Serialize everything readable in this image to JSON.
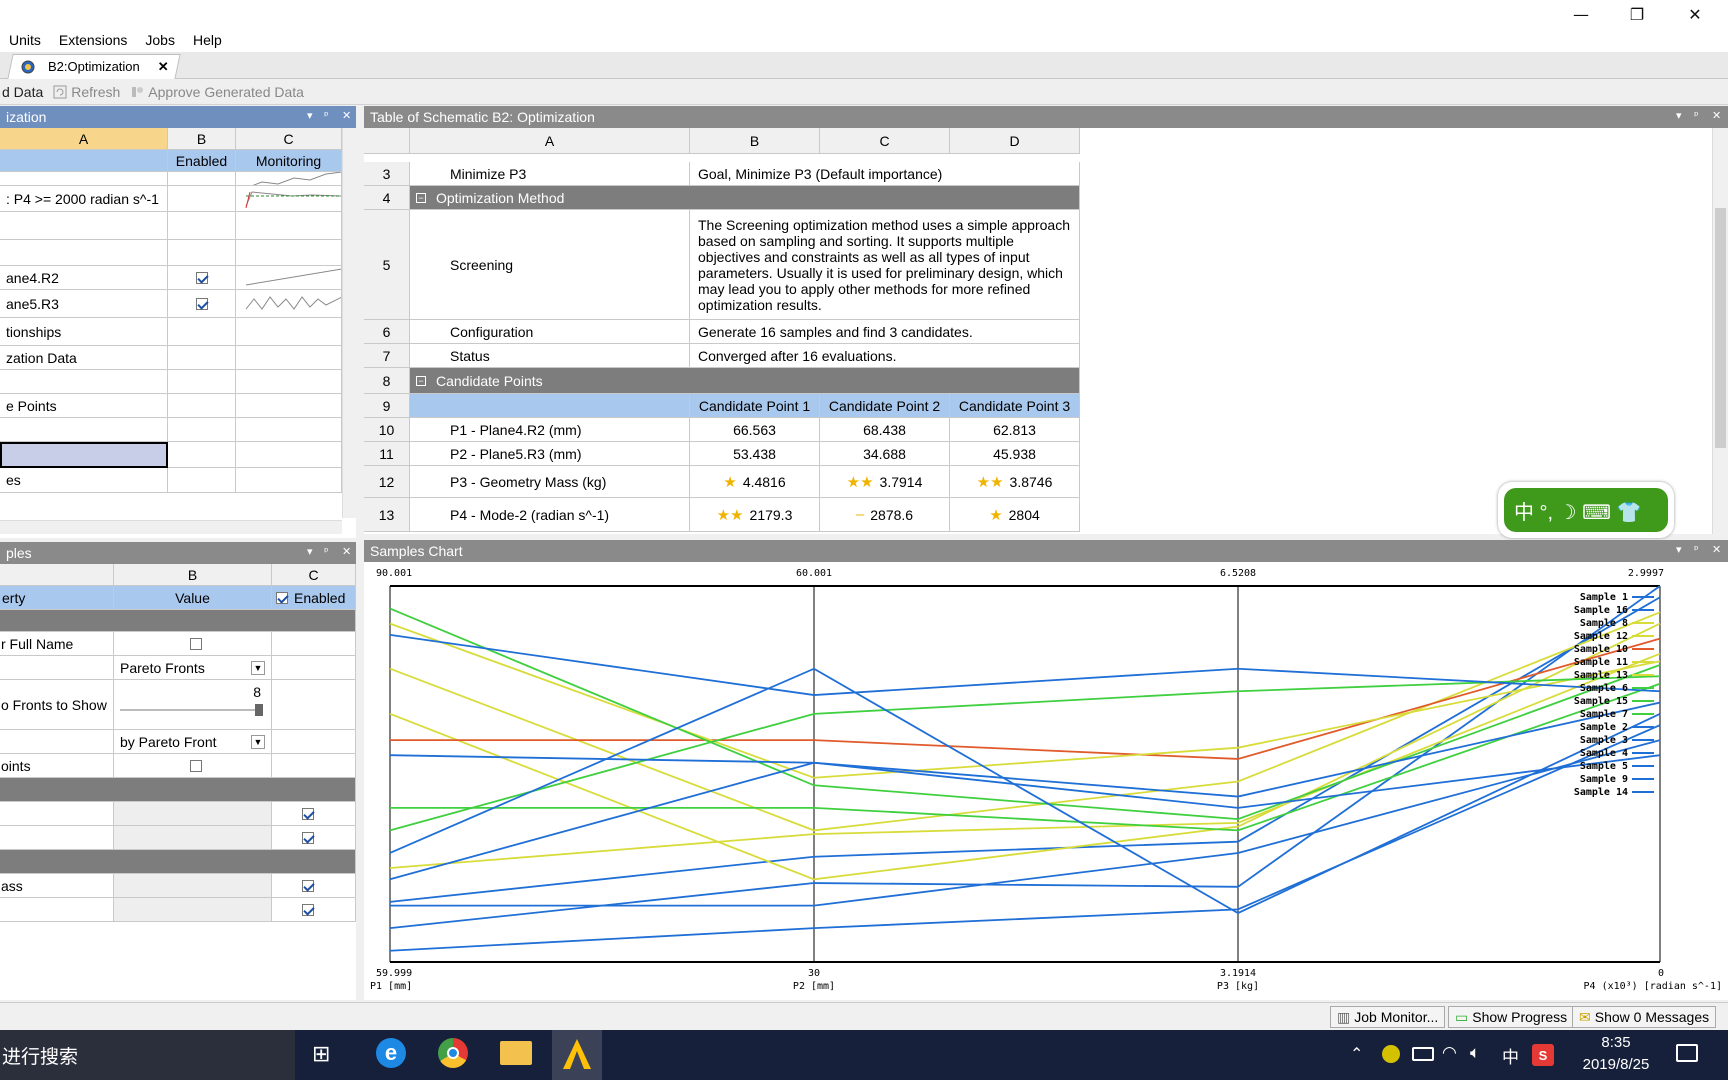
{
  "window_controls": {
    "minimize": "—",
    "restore": "❐",
    "close": "✕"
  },
  "menu": [
    "Units",
    "Extensions",
    "Jobs",
    "Help"
  ],
  "doc_tab": {
    "label": "B2:Optimization",
    "close": "✕"
  },
  "toolbar": {
    "update_label": "d Data",
    "refresh_label": "Refresh",
    "approve_label": "Approve Generated Data"
  },
  "outline": {
    "title": "ization",
    "col_a": "A",
    "col_b": "B",
    "col_c": "C",
    "hdr_b": "Enabled",
    "hdr_c": "Monitoring",
    "rows": [
      "",
      ": P4 >= 2000 radian s^-1",
      "",
      "",
      "ane4.R2",
      "ane5.R3",
      "tionships",
      "zation Data",
      "",
      "e Points",
      "",
      "",
      "es"
    ]
  },
  "props": {
    "title": "ples",
    "col_b": "B",
    "col_c": "C",
    "hdr_a": "erty",
    "hdr_b": "Value",
    "hdr_c": "Enabled",
    "rows": {
      "full_name": "r Full Name",
      "mode_value": "Pareto Fronts",
      "fronts": "o Fronts to Show",
      "fronts_value": "8",
      "color_value": "by Pareto Front",
      "points": "oints",
      "mass": "ass"
    }
  },
  "table": {
    "title": "Table of Schematic B2: Optimization",
    "cols": [
      "A",
      "B",
      "C",
      "D"
    ],
    "rows": [
      {
        "n": "3",
        "a": "Minimize P3",
        "b": "Goal, Minimize P3 (Default importance)"
      },
      {
        "n": "4",
        "section": "Optimization Method"
      },
      {
        "n": "5",
        "a": "Screening",
        "b": "The Screening optimization method uses a simple approach based on sampling and sorting. It supports multiple objectives and constraints as well as all types of input parameters. Usually it is used for preliminary design, which may lead you to apply other methods for more refined optimization results."
      },
      {
        "n": "6",
        "a": "Configuration",
        "b": "Generate 16 samples and find 3 candidates."
      },
      {
        "n": "7",
        "a": "Status",
        "b": "Converged after 16 evaluations."
      },
      {
        "n": "8",
        "section": "Candidate Points"
      },
      {
        "n": "9",
        "cp": [
          "Candidate Point 1",
          "Candidate Point 2",
          "Candidate Point 3"
        ]
      },
      {
        "n": "10",
        "a": "P1 - Plane4.R2 (mm)",
        "vals": [
          "66.563",
          "68.438",
          "62.813"
        ]
      },
      {
        "n": "11",
        "a": "P2 - Plane5.R3 (mm)",
        "vals": [
          "53.438",
          "34.688",
          "45.938"
        ]
      },
      {
        "n": "12",
        "a": "P3 - Geometry Mass (kg)",
        "vals": [
          "4.4816",
          "3.7914",
          "3.8746"
        ],
        "stars": [
          "★",
          "★★",
          "★★"
        ]
      },
      {
        "n": "13",
        "a": "P4 - Mode-2 (radian s^-1)",
        "vals": [
          "2179.3",
          "2878.6",
          "2804"
        ],
        "stars": [
          "★★",
          "–",
          "★"
        ]
      }
    ]
  },
  "samples_chart": {
    "title": "Samples Chart"
  },
  "chart_data": {
    "type": "line",
    "subtype": "parallel-coordinates",
    "axes": [
      {
        "label": "P1 [mm]",
        "top": "90.001",
        "bottom": "59.999"
      },
      {
        "label": "P2 [mm]",
        "top": "60.001",
        "bottom": "30"
      },
      {
        "label": "P3 [kg]",
        "top": "6.5208",
        "bottom": "3.1914"
      },
      {
        "label": "P4 (x10³) [radian s^-1]",
        "top": "2.9997",
        "bottom": "0"
      }
    ],
    "series": [
      {
        "name": "Sample 1",
        "color": "#1f6fd6",
        "values": [
          0.09,
          0.21,
          0.2,
          1.0
        ]
      },
      {
        "name": "Sample 16",
        "color": "#1f6fd6",
        "values": [
          0.16,
          0.28,
          0.32,
          0.97
        ]
      },
      {
        "name": "Sample 8",
        "color": "#d8dc3a",
        "values": [
          0.78,
          0.35,
          0.48,
          0.93
        ]
      },
      {
        "name": "Sample 12",
        "color": "#d8dc3a",
        "values": [
          0.66,
          0.22,
          0.36,
          0.9
        ]
      },
      {
        "name": "Sample 10",
        "color": "#e05a2b",
        "values": [
          0.59,
          0.59,
          0.54,
          0.86
        ]
      },
      {
        "name": "Sample 11",
        "color": "#d8dc3a",
        "values": [
          0.9,
          0.49,
          0.57,
          0.8
        ]
      },
      {
        "name": "Sample 13",
        "color": "#d8dc3a",
        "values": [
          0.25,
          0.34,
          0.37,
          0.82
        ]
      },
      {
        "name": "Sample 6",
        "color": "#3fcf3f",
        "values": [
          0.94,
          0.47,
          0.38,
          0.79
        ]
      },
      {
        "name": "Sample 15",
        "color": "#3fcf3f",
        "values": [
          0.35,
          0.66,
          0.72,
          0.76
        ]
      },
      {
        "name": "Sample 7",
        "color": "#3fcf3f",
        "values": [
          0.41,
          0.41,
          0.35,
          0.74
        ]
      },
      {
        "name": "Sample 2",
        "color": "#1f6fd6",
        "values": [
          0.87,
          0.71,
          0.78,
          0.72
        ]
      },
      {
        "name": "Sample 3",
        "color": "#1f6fd6",
        "values": [
          0.55,
          0.53,
          0.44,
          0.69
        ]
      },
      {
        "name": "Sample 4",
        "color": "#1f6fd6",
        "values": [
          0.29,
          0.78,
          0.13,
          0.66
        ]
      },
      {
        "name": "Sample 5",
        "color": "#1f6fd6",
        "values": [
          0.03,
          0.09,
          0.14,
          0.63
        ]
      },
      {
        "name": "Sample 9",
        "color": "#1f6fd6",
        "values": [
          0.15,
          0.15,
          0.29,
          0.59
        ]
      },
      {
        "name": "Sample 14",
        "color": "#1f6fd6",
        "values": [
          0.22,
          0.53,
          0.41,
          0.55
        ]
      }
    ],
    "legend_position": "top-right"
  },
  "statusbar": {
    "job": "Job Monitor...",
    "progress": "Show Progress",
    "messages": "Show 0 Messages"
  },
  "taskbar": {
    "search": "进行搜索",
    "ime_lang": "中",
    "time": "8:35",
    "date": "2019/8/25"
  },
  "ime_bar": {
    "label": "中 °, ☽ ⌨ 👕"
  }
}
